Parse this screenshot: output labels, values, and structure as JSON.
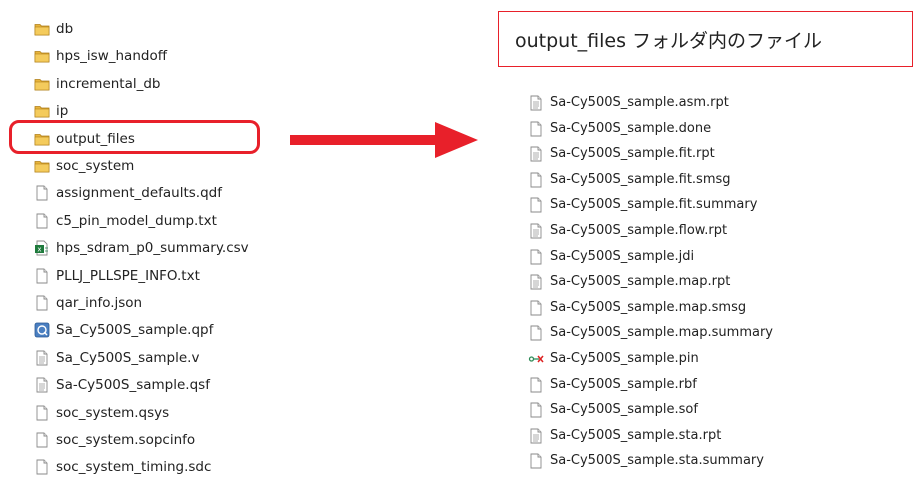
{
  "caption": "output_files フォルダ内のファイル",
  "colors": {
    "highlight": "#e8202a",
    "folder": "#e8b43c"
  },
  "left_files": [
    {
      "name": "db",
      "icon": "folder-icon"
    },
    {
      "name": "hps_isw_handoff",
      "icon": "folder-icon"
    },
    {
      "name": "incremental_db",
      "icon": "folder-icon"
    },
    {
      "name": "ip",
      "icon": "folder-icon"
    },
    {
      "name": "output_files",
      "icon": "folder-icon"
    },
    {
      "name": "soc_system",
      "icon": "folder-icon"
    },
    {
      "name": "assignment_defaults.qdf",
      "icon": "file-icon"
    },
    {
      "name": "c5_pin_model_dump.txt",
      "icon": "file-icon"
    },
    {
      "name": "hps_sdram_p0_summary.csv",
      "icon": "csv-icon"
    },
    {
      "name": "PLLJ_PLLSPE_INFO.txt",
      "icon": "file-icon"
    },
    {
      "name": "qar_info.json",
      "icon": "file-icon"
    },
    {
      "name": "Sa_Cy500S_sample.qpf",
      "icon": "quartus-project-icon"
    },
    {
      "name": "Sa_Cy500S_sample.v",
      "icon": "text-file-icon"
    },
    {
      "name": "Sa-Cy500S_sample.qsf",
      "icon": "text-file-icon"
    },
    {
      "name": "soc_system.qsys",
      "icon": "file-icon"
    },
    {
      "name": "soc_system.sopcinfo",
      "icon": "file-icon"
    },
    {
      "name": "soc_system_timing.sdc",
      "icon": "file-icon"
    }
  ],
  "right_files": [
    {
      "name": "Sa-Cy500S_sample.asm.rpt",
      "icon": "text-file-icon"
    },
    {
      "name": "Sa-Cy500S_sample.done",
      "icon": "file-icon"
    },
    {
      "name": "Sa-Cy500S_sample.fit.rpt",
      "icon": "text-file-icon"
    },
    {
      "name": "Sa-Cy500S_sample.fit.smsg",
      "icon": "file-icon"
    },
    {
      "name": "Sa-Cy500S_sample.fit.summary",
      "icon": "file-icon"
    },
    {
      "name": "Sa-Cy500S_sample.flow.rpt",
      "icon": "text-file-icon"
    },
    {
      "name": "Sa-Cy500S_sample.jdi",
      "icon": "file-icon"
    },
    {
      "name": "Sa-Cy500S_sample.map.rpt",
      "icon": "text-file-icon"
    },
    {
      "name": "Sa-Cy500S_sample.map.smsg",
      "icon": "file-icon"
    },
    {
      "name": "Sa-Cy500S_sample.map.summary",
      "icon": "file-icon"
    },
    {
      "name": "Sa-Cy500S_sample.pin",
      "icon": "pin-icon"
    },
    {
      "name": "Sa-Cy500S_sample.rbf",
      "icon": "file-icon"
    },
    {
      "name": "Sa-Cy500S_sample.sof",
      "icon": "file-icon"
    },
    {
      "name": "Sa-Cy500S_sample.sta.rpt",
      "icon": "text-file-icon"
    },
    {
      "name": "Sa-Cy500S_sample.sta.summary",
      "icon": "file-icon"
    }
  ]
}
